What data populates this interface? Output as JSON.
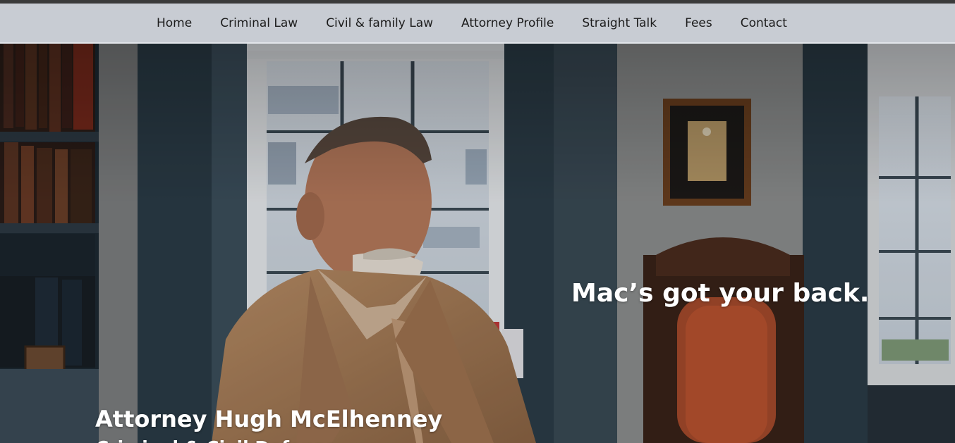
{
  "nav": {
    "items": [
      {
        "label": "Home"
      },
      {
        "label": "Criminal Law"
      },
      {
        "label": "Civil & family Law"
      },
      {
        "label": "Attorney Profile"
      },
      {
        "label": "Straight Talk"
      },
      {
        "label": "Fees"
      },
      {
        "label": "Contact"
      }
    ]
  },
  "hero": {
    "tagline": "Mac’s got your back.",
    "name": "Attorney Hugh McElhenney",
    "subtitle": "Criminal & Civil Defense"
  },
  "colors": {
    "nav_background": "#c8ccd3",
    "nav_text": "#1c1c1c",
    "hero_text": "#ffffff"
  }
}
